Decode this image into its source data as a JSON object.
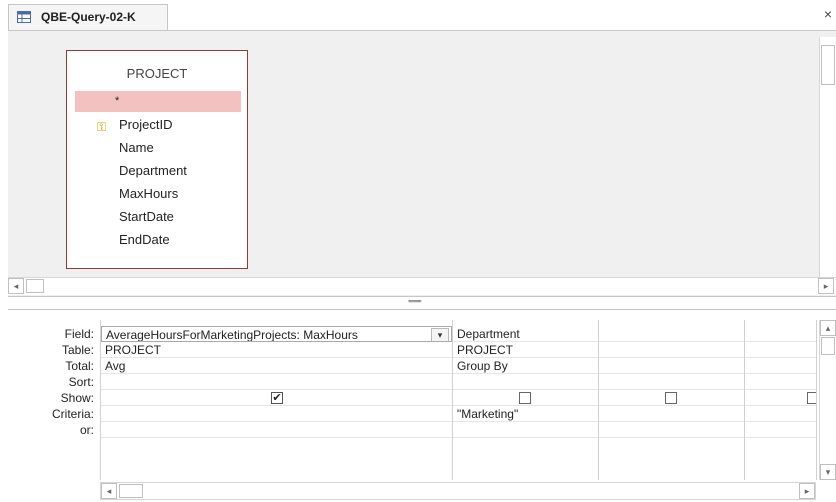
{
  "tab": {
    "title": "QBE-Query-02-K",
    "close_glyph": "×"
  },
  "table_box": {
    "title": "PROJECT",
    "fields": [
      "*",
      "ProjectID",
      "Name",
      "Department",
      "MaxHours",
      "StartDate",
      "EndDate"
    ],
    "key_field_index": 1
  },
  "grid": {
    "row_labels": [
      "Field:",
      "Table:",
      "Total:",
      "Sort:",
      "Show:",
      "Criteria:",
      "or:"
    ],
    "columns": [
      {
        "field": "AverageHoursForMarketingProjects: MaxHours",
        "table": "PROJECT",
        "total": "Avg",
        "sort": "",
        "show": true,
        "criteria": "",
        "or": ""
      },
      {
        "field": "Department",
        "table": "PROJECT",
        "total": "Group By",
        "sort": "",
        "show": false,
        "criteria": "\"Marketing\"",
        "or": ""
      },
      {
        "field": "",
        "table": "",
        "total": "",
        "sort": "",
        "show": false,
        "criteria": "",
        "or": ""
      },
      {
        "field": "",
        "table": "",
        "total": "",
        "sort": "",
        "show": false,
        "criteria": "",
        "or": ""
      }
    ]
  },
  "icons": {
    "query": "query-icon",
    "key": "primary-key-icon",
    "dropdown": "chevron-down-icon",
    "scroll_left": "◂",
    "scroll_right": "▸",
    "scroll_up": "▴",
    "scroll_down": "▾",
    "check": "✔"
  },
  "colors": {
    "star_row_bg": "#f4c1c1",
    "table_border": "#8e3b3b"
  }
}
